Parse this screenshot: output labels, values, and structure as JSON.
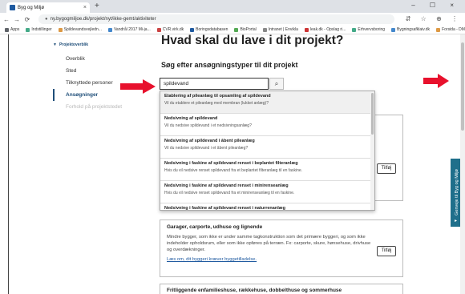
{
  "browser": {
    "tab_title": "Byg og Miljø",
    "tab_close": "×",
    "new_tab": "+",
    "window_controls": "– ☐ ×",
    "url": "ny.bygogmiljoe.dk/projekt/nyt/ikke-gemt/aktiviteter",
    "back_glyph": "←",
    "forward_glyph": "→",
    "reload_glyph": "⟳",
    "toolbar_right": "⇵ ☆ ⊕ ⋮",
    "bookmarks": [
      {
        "label": "Apps",
        "color": "#5f6368"
      },
      {
        "label": "Indstillinger",
        "color": "#4a8"
      },
      {
        "label": "Spildevandsvejledn...",
        "color": "#d94"
      },
      {
        "label": "Vandrål 2017 Mi-ja...",
        "color": "#48c"
      },
      {
        "label": "CVR.virk.dk",
        "color": "#c44"
      },
      {
        "label": "Boringsdatabasen",
        "color": "#1f5aa0"
      },
      {
        "label": "BioPortal",
        "color": "#5a5"
      },
      {
        "label": "Intranet | Envikla",
        "color": "#888"
      },
      {
        "label": "leak.dk - Opslag ri...",
        "color": "#c33"
      },
      {
        "label": "Erhvervsboring",
        "color": "#4a8"
      },
      {
        "label": "Bygningsafklaiv.dk",
        "color": "#48c"
      },
      {
        "label": "Forsida - DMA",
        "color": "#d94"
      }
    ]
  },
  "sidebar": {
    "header": "Projektoverblik",
    "header_icon": "▼",
    "items": [
      {
        "label": "Overblik",
        "state": "normal"
      },
      {
        "label": "Sted",
        "state": "normal"
      },
      {
        "label": "Tilknyttede personer",
        "state": "normal"
      },
      {
        "label": "Ansøgninger",
        "state": "active"
      },
      {
        "label": "Forhold på projektstedet",
        "state": "disabled"
      }
    ]
  },
  "main": {
    "heading": "Hvad skal du lave i dit projekt?",
    "subheading": "Søg efter ansøgningstyper til dit projekt",
    "search_value": "spildevand",
    "search_button_icon": "🔍"
  },
  "dropdown": {
    "items": [
      {
        "title": "Etablering af pileanlæg til opsamling af spildevand",
        "desc": "Vil du etablere et pileanlæg med membran (lukket anlæg)?"
      },
      {
        "title": "Nedsivning af spildevand",
        "desc": "Vil du nedsive spildevand i et nedsivningsanlæg?"
      },
      {
        "title": "Nedsivning af spildevand i åbent pileanlæg",
        "desc": "Vil du nedsive spildevand i et åbent pileanlæg?"
      },
      {
        "title": "Nedsivning i faskine af spildevand renset i beplantet filteranlæg",
        "desc": "Hvis du vil nedsive renset spildevand fra et beplantet filteranlæg til en faskine."
      },
      {
        "title": "Nedsivning i faskine af spildevand renset i minirenseanlæg",
        "desc": "Hvis du vil nedsive renset spildevand fra et minirenseanlæg til en faskine."
      },
      {
        "title": "Nedsivning i faskine af spildevand renset i naturrenanlæg",
        "desc": ""
      }
    ]
  },
  "cards": {
    "add_label": "Tilføj",
    "garage": {
      "title": "Garager, carporte, udhuse og lignende",
      "text": "Mindre bygger, som ikke er under samme tagkonstruktion som det primære byggeri, og som ikke indeholder opholdsrum, eller som ikke opføres på terræn. Fx: carporte, skure, hønsehuse, drivhuse og overdækninger.",
      "link": "Læs om, dit byggeri kræver byggetilladelse."
    },
    "bottom": {
      "title": "Fritliggende enfamilieshuse, rækkehuse, dobbelthuse og sommerhuse"
    }
  },
  "side_tab": {
    "label": "Genveje til Byg og Miljø",
    "arrow": "▸",
    "color": "#1f6f8b"
  },
  "arrows": {
    "color": "#e8112d"
  }
}
